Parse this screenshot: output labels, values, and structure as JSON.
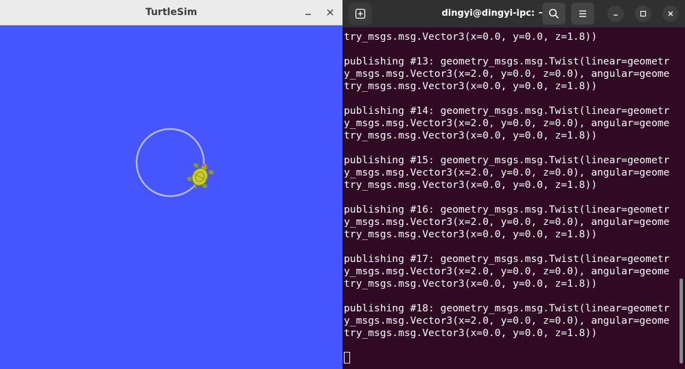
{
  "turtlesim": {
    "title": "TurtleSim",
    "background_color": "#4556ff",
    "trail_color": "#b3b8ff",
    "turtle_icon": "turtle-icon"
  },
  "terminal": {
    "title": "dingyi@dingyi-ipc: ~",
    "background_color": "#300a24",
    "icons": {
      "new_tab": "new-tab-icon",
      "search": "search-icon",
      "menu": "hamburger-menu-icon",
      "minimize": "minimize-icon",
      "maximize": "maximize-icon",
      "close": "close-icon"
    },
    "lines": [
      "try_msgs.msg.Vector3(x=0.0, y=0.0, z=1.8))",
      "",
      "publishing #13: geometry_msgs.msg.Twist(linear=geometr",
      "y_msgs.msg.Vector3(x=2.0, y=0.0, z=0.0), angular=geome",
      "try_msgs.msg.Vector3(x=0.0, y=0.0, z=1.8))",
      "",
      "publishing #14: geometry_msgs.msg.Twist(linear=geometr",
      "y_msgs.msg.Vector3(x=2.0, y=0.0, z=0.0), angular=geome",
      "try_msgs.msg.Vector3(x=0.0, y=0.0, z=1.8))",
      "",
      "publishing #15: geometry_msgs.msg.Twist(linear=geometr",
      "y_msgs.msg.Vector3(x=2.0, y=0.0, z=0.0), angular=geome",
      "try_msgs.msg.Vector3(x=0.0, y=0.0, z=1.8))",
      "",
      "publishing #16: geometry_msgs.msg.Twist(linear=geometr",
      "y_msgs.msg.Vector3(x=2.0, y=0.0, z=0.0), angular=geome",
      "try_msgs.msg.Vector3(x=0.0, y=0.0, z=1.8))",
      "",
      "publishing #17: geometry_msgs.msg.Twist(linear=geometr",
      "y_msgs.msg.Vector3(x=2.0, y=0.0, z=0.0), angular=geome",
      "try_msgs.msg.Vector3(x=0.0, y=0.0, z=1.8))",
      "",
      "publishing #18: geometry_msgs.msg.Twist(linear=geometr",
      "y_msgs.msg.Vector3(x=2.0, y=0.0, z=0.0), angular=geome",
      "try_msgs.msg.Vector3(x=0.0, y=0.0, z=1.8))",
      ""
    ]
  }
}
